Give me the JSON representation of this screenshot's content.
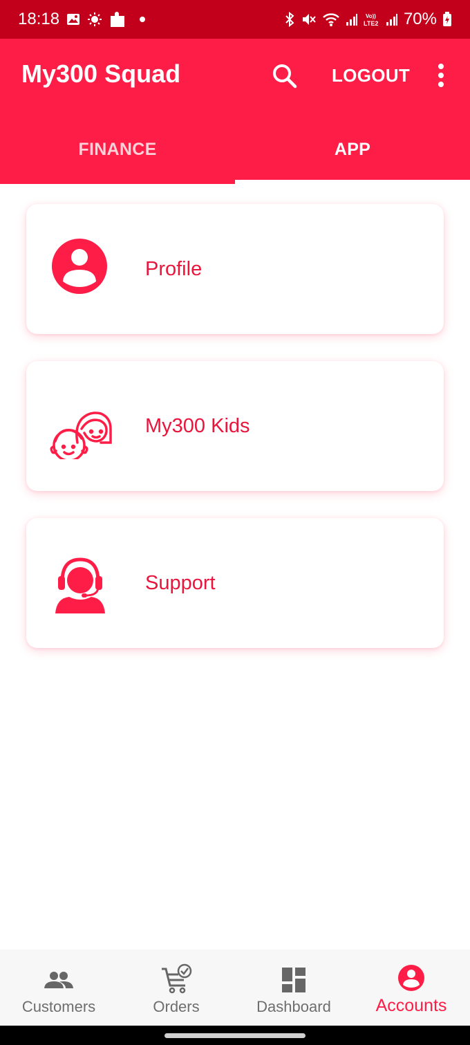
{
  "status_bar": {
    "time": "18:18",
    "battery": "70%",
    "icons": [
      "gallery-icon",
      "brightness-icon",
      "puzzle-icon",
      "bluetooth-icon",
      "mute-icon",
      "wifi-icon",
      "signal-icon",
      "volte-icon",
      "signal-icon",
      "battery-icon"
    ]
  },
  "app_bar": {
    "title": "My300 Squad",
    "logout_label": "LOGOUT",
    "search_icon": "search-icon",
    "more_icon": "more-vert-icon",
    "background": "#fe1d47"
  },
  "tabs": [
    {
      "label": "FINANCE",
      "active": false
    },
    {
      "label": "APP",
      "active": true
    }
  ],
  "cards": [
    {
      "label": "Profile",
      "icon": "profile-icon"
    },
    {
      "label": "My300 Kids",
      "icon": "kids-icon"
    },
    {
      "label": "Support",
      "icon": "support-icon"
    }
  ],
  "bottom_nav": [
    {
      "label": "Customers",
      "icon": "people-icon",
      "active": false
    },
    {
      "label": "Orders",
      "icon": "cart-check-icon",
      "active": false
    },
    {
      "label": "Dashboard",
      "icon": "dashboard-icon",
      "active": false
    },
    {
      "label": "Accounts",
      "icon": "account-circle-icon",
      "active": true
    }
  ],
  "colors": {
    "accent": "#fe1d47",
    "status_bar": "#c3001c",
    "card_text": "#e8163c",
    "inactive_nav": "#6e6e6e"
  }
}
